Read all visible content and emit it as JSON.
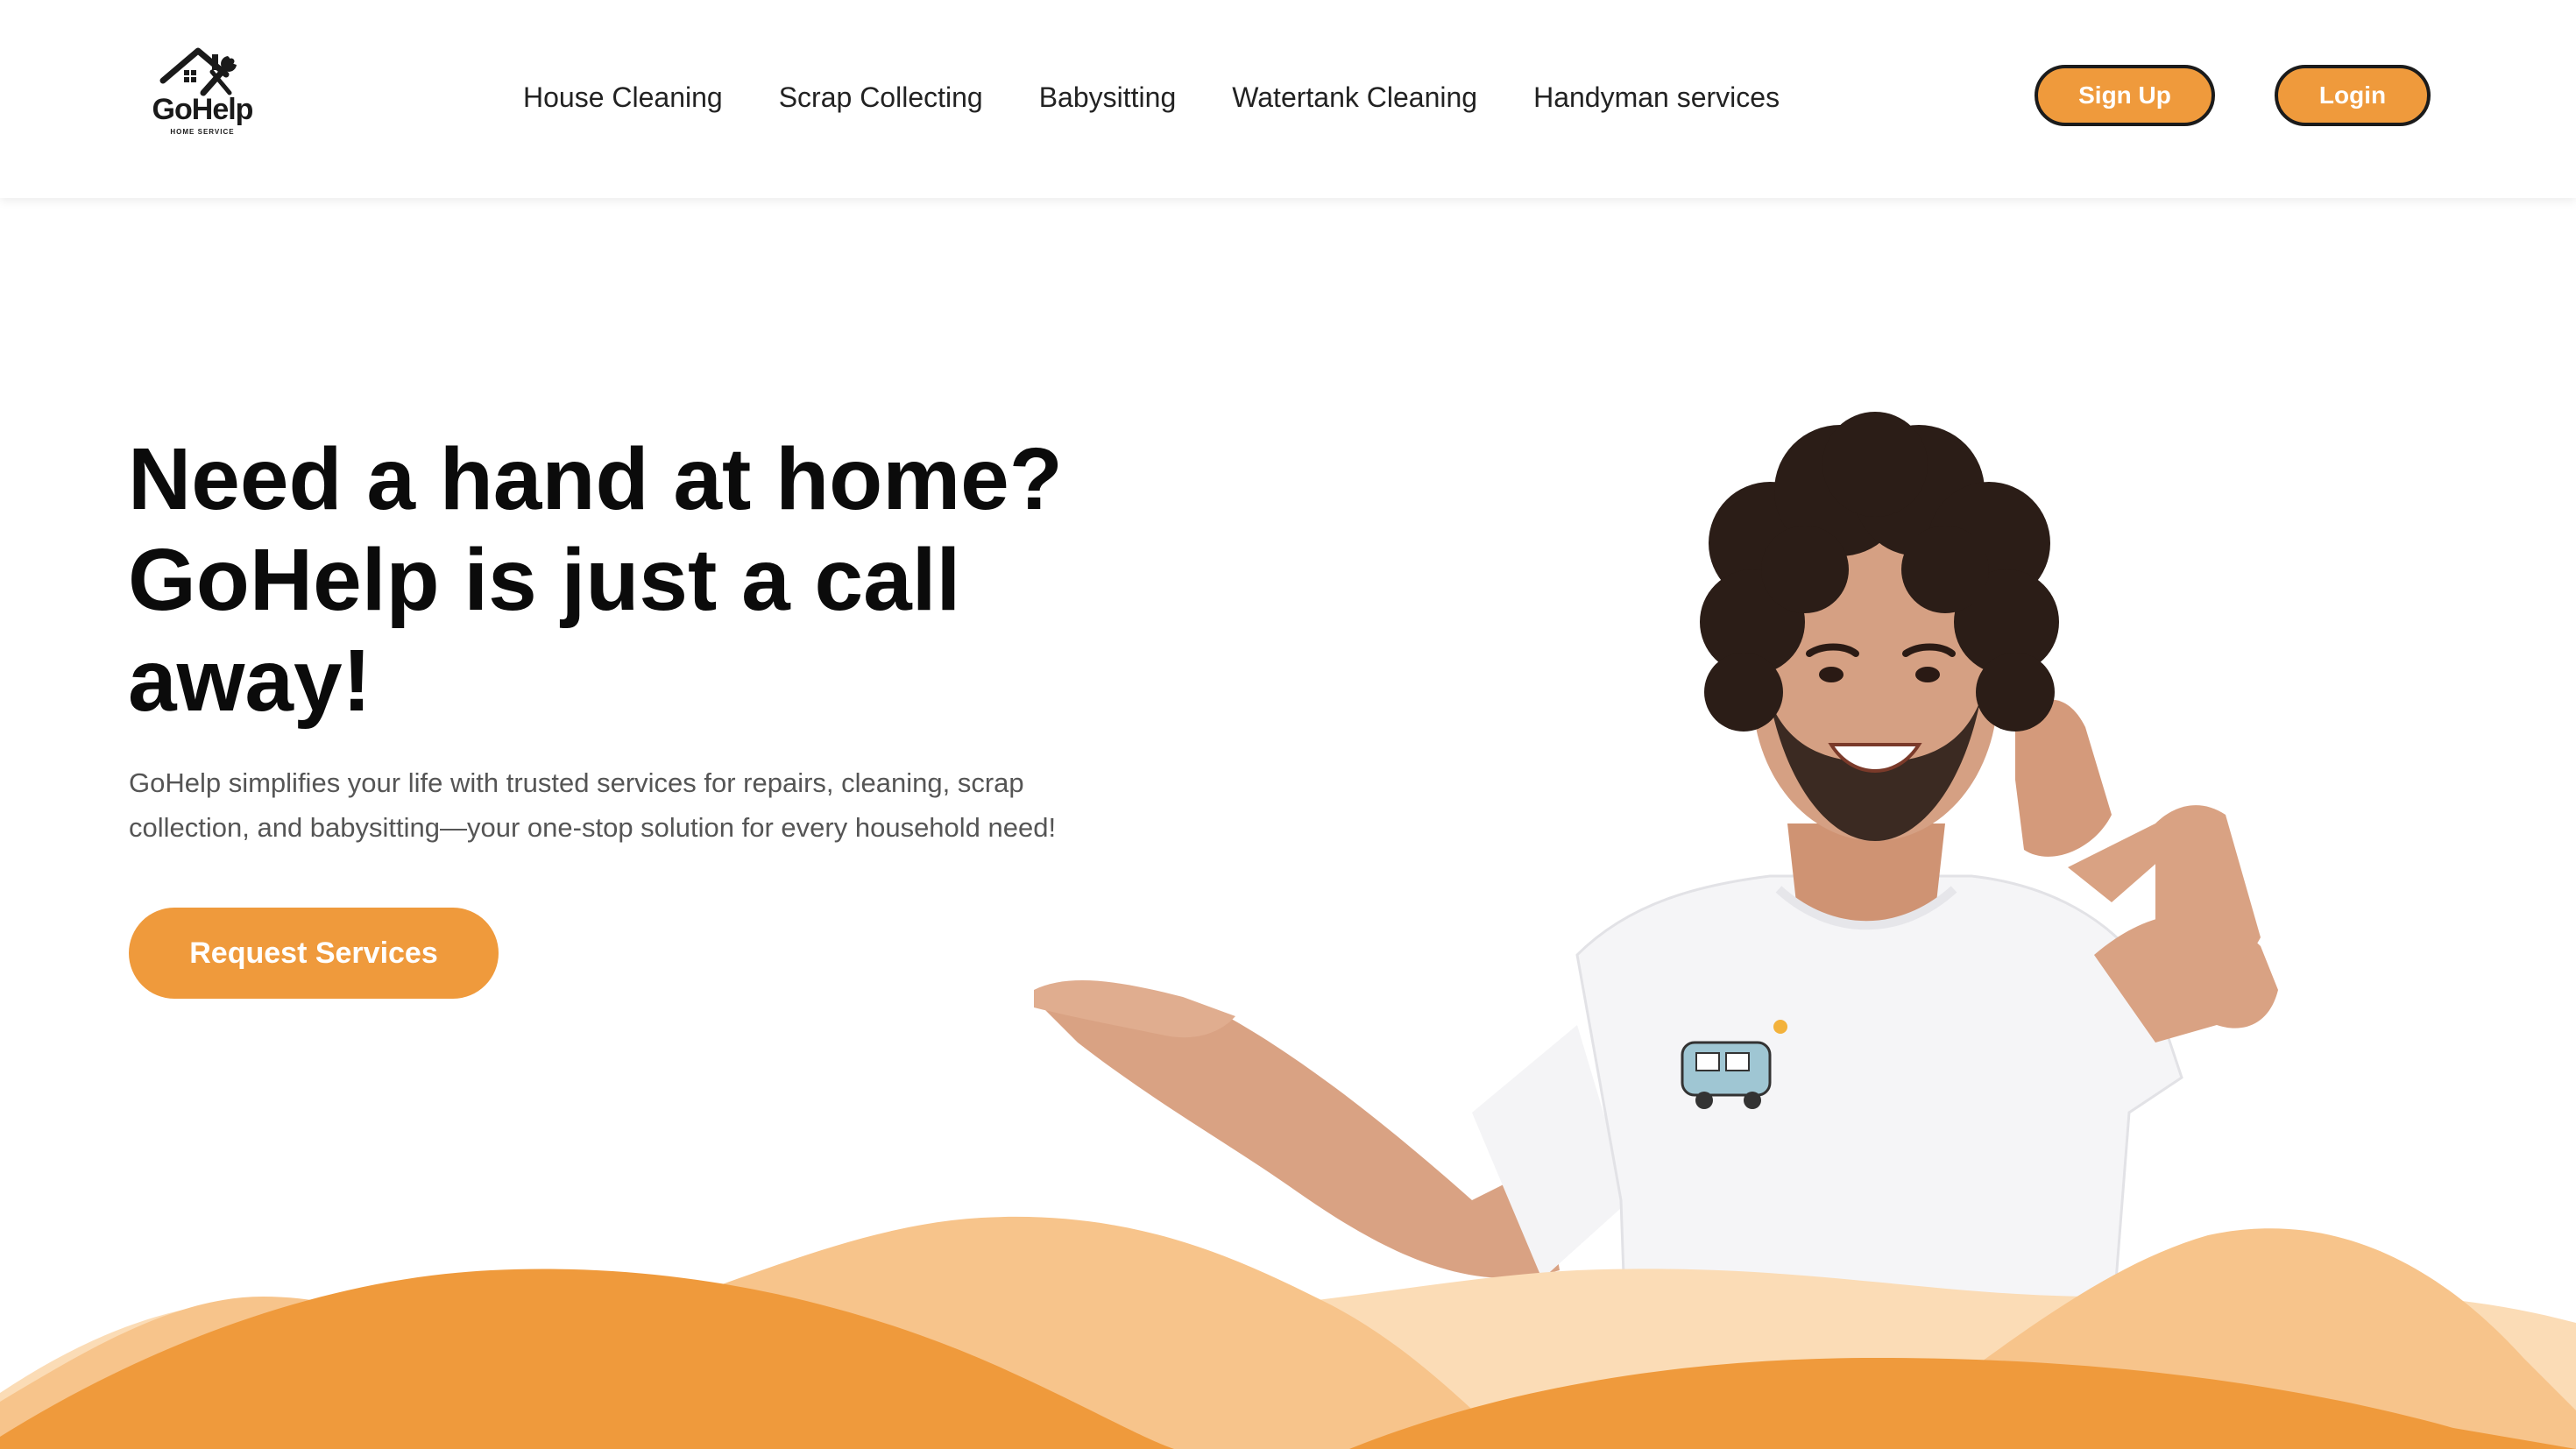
{
  "header": {
    "logo": {
      "text": "GoHelp",
      "subtext": "HOME SERVICE"
    },
    "nav": [
      {
        "label": "House Cleaning"
      },
      {
        "label": "Scrap Collecting"
      },
      {
        "label": "Babysitting"
      },
      {
        "label": "Watertank Cleaning"
      },
      {
        "label": "Handyman services"
      }
    ],
    "signup_label": "Sign Up",
    "login_label": "Login"
  },
  "hero": {
    "title": "Need a hand at home? GoHelp is just a call away!",
    "description": "GoHelp simplifies your life with trusted services for repairs, cleaning, scrap collection, and babysitting—your one-stop solution for every household need!",
    "cta_label": "Request Services"
  },
  "theme": {
    "accent": "#ef9a3c",
    "wave_light": "#f7c48b",
    "wave_lighter": "#fbdcb6",
    "text_dark": "#0b0b0b",
    "text_muted": "#555555"
  },
  "icons": {
    "logo": "house-wrench-icon"
  }
}
